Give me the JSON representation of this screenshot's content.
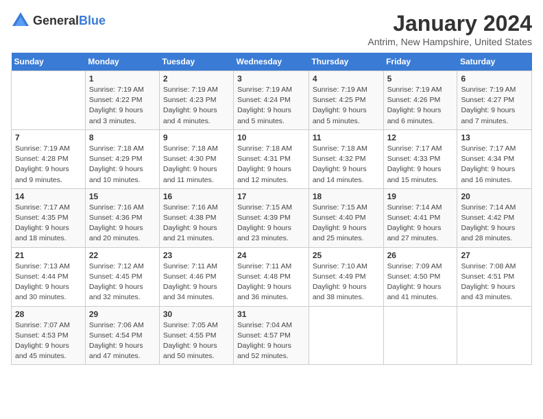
{
  "header": {
    "logo": {
      "general": "General",
      "blue": "Blue"
    },
    "title": "January 2024",
    "subtitle": "Antrim, New Hampshire, United States"
  },
  "calendar": {
    "days_of_week": [
      "Sunday",
      "Monday",
      "Tuesday",
      "Wednesday",
      "Thursday",
      "Friday",
      "Saturday"
    ],
    "weeks": [
      [
        {
          "day": "",
          "info": ""
        },
        {
          "day": "1",
          "info": "Sunrise: 7:19 AM\nSunset: 4:22 PM\nDaylight: 9 hours\nand 3 minutes."
        },
        {
          "day": "2",
          "info": "Sunrise: 7:19 AM\nSunset: 4:23 PM\nDaylight: 9 hours\nand 4 minutes."
        },
        {
          "day": "3",
          "info": "Sunrise: 7:19 AM\nSunset: 4:24 PM\nDaylight: 9 hours\nand 5 minutes."
        },
        {
          "day": "4",
          "info": "Sunrise: 7:19 AM\nSunset: 4:25 PM\nDaylight: 9 hours\nand 5 minutes."
        },
        {
          "day": "5",
          "info": "Sunrise: 7:19 AM\nSunset: 4:26 PM\nDaylight: 9 hours\nand 6 minutes."
        },
        {
          "day": "6",
          "info": "Sunrise: 7:19 AM\nSunset: 4:27 PM\nDaylight: 9 hours\nand 7 minutes."
        }
      ],
      [
        {
          "day": "7",
          "info": "Sunrise: 7:19 AM\nSunset: 4:28 PM\nDaylight: 9 hours\nand 9 minutes."
        },
        {
          "day": "8",
          "info": "Sunrise: 7:18 AM\nSunset: 4:29 PM\nDaylight: 9 hours\nand 10 minutes."
        },
        {
          "day": "9",
          "info": "Sunrise: 7:18 AM\nSunset: 4:30 PM\nDaylight: 9 hours\nand 11 minutes."
        },
        {
          "day": "10",
          "info": "Sunrise: 7:18 AM\nSunset: 4:31 PM\nDaylight: 9 hours\nand 12 minutes."
        },
        {
          "day": "11",
          "info": "Sunrise: 7:18 AM\nSunset: 4:32 PM\nDaylight: 9 hours\nand 14 minutes."
        },
        {
          "day": "12",
          "info": "Sunrise: 7:17 AM\nSunset: 4:33 PM\nDaylight: 9 hours\nand 15 minutes."
        },
        {
          "day": "13",
          "info": "Sunrise: 7:17 AM\nSunset: 4:34 PM\nDaylight: 9 hours\nand 16 minutes."
        }
      ],
      [
        {
          "day": "14",
          "info": "Sunrise: 7:17 AM\nSunset: 4:35 PM\nDaylight: 9 hours\nand 18 minutes."
        },
        {
          "day": "15",
          "info": "Sunrise: 7:16 AM\nSunset: 4:36 PM\nDaylight: 9 hours\nand 20 minutes."
        },
        {
          "day": "16",
          "info": "Sunrise: 7:16 AM\nSunset: 4:38 PM\nDaylight: 9 hours\nand 21 minutes."
        },
        {
          "day": "17",
          "info": "Sunrise: 7:15 AM\nSunset: 4:39 PM\nDaylight: 9 hours\nand 23 minutes."
        },
        {
          "day": "18",
          "info": "Sunrise: 7:15 AM\nSunset: 4:40 PM\nDaylight: 9 hours\nand 25 minutes."
        },
        {
          "day": "19",
          "info": "Sunrise: 7:14 AM\nSunset: 4:41 PM\nDaylight: 9 hours\nand 27 minutes."
        },
        {
          "day": "20",
          "info": "Sunrise: 7:14 AM\nSunset: 4:42 PM\nDaylight: 9 hours\nand 28 minutes."
        }
      ],
      [
        {
          "day": "21",
          "info": "Sunrise: 7:13 AM\nSunset: 4:44 PM\nDaylight: 9 hours\nand 30 minutes."
        },
        {
          "day": "22",
          "info": "Sunrise: 7:12 AM\nSunset: 4:45 PM\nDaylight: 9 hours\nand 32 minutes."
        },
        {
          "day": "23",
          "info": "Sunrise: 7:11 AM\nSunset: 4:46 PM\nDaylight: 9 hours\nand 34 minutes."
        },
        {
          "day": "24",
          "info": "Sunrise: 7:11 AM\nSunset: 4:48 PM\nDaylight: 9 hours\nand 36 minutes."
        },
        {
          "day": "25",
          "info": "Sunrise: 7:10 AM\nSunset: 4:49 PM\nDaylight: 9 hours\nand 38 minutes."
        },
        {
          "day": "26",
          "info": "Sunrise: 7:09 AM\nSunset: 4:50 PM\nDaylight: 9 hours\nand 41 minutes."
        },
        {
          "day": "27",
          "info": "Sunrise: 7:08 AM\nSunset: 4:51 PM\nDaylight: 9 hours\nand 43 minutes."
        }
      ],
      [
        {
          "day": "28",
          "info": "Sunrise: 7:07 AM\nSunset: 4:53 PM\nDaylight: 9 hours\nand 45 minutes."
        },
        {
          "day": "29",
          "info": "Sunrise: 7:06 AM\nSunset: 4:54 PM\nDaylight: 9 hours\nand 47 minutes."
        },
        {
          "day": "30",
          "info": "Sunrise: 7:05 AM\nSunset: 4:55 PM\nDaylight: 9 hours\nand 50 minutes."
        },
        {
          "day": "31",
          "info": "Sunrise: 7:04 AM\nSunset: 4:57 PM\nDaylight: 9 hours\nand 52 minutes."
        },
        {
          "day": "",
          "info": ""
        },
        {
          "day": "",
          "info": ""
        },
        {
          "day": "",
          "info": ""
        }
      ]
    ]
  }
}
